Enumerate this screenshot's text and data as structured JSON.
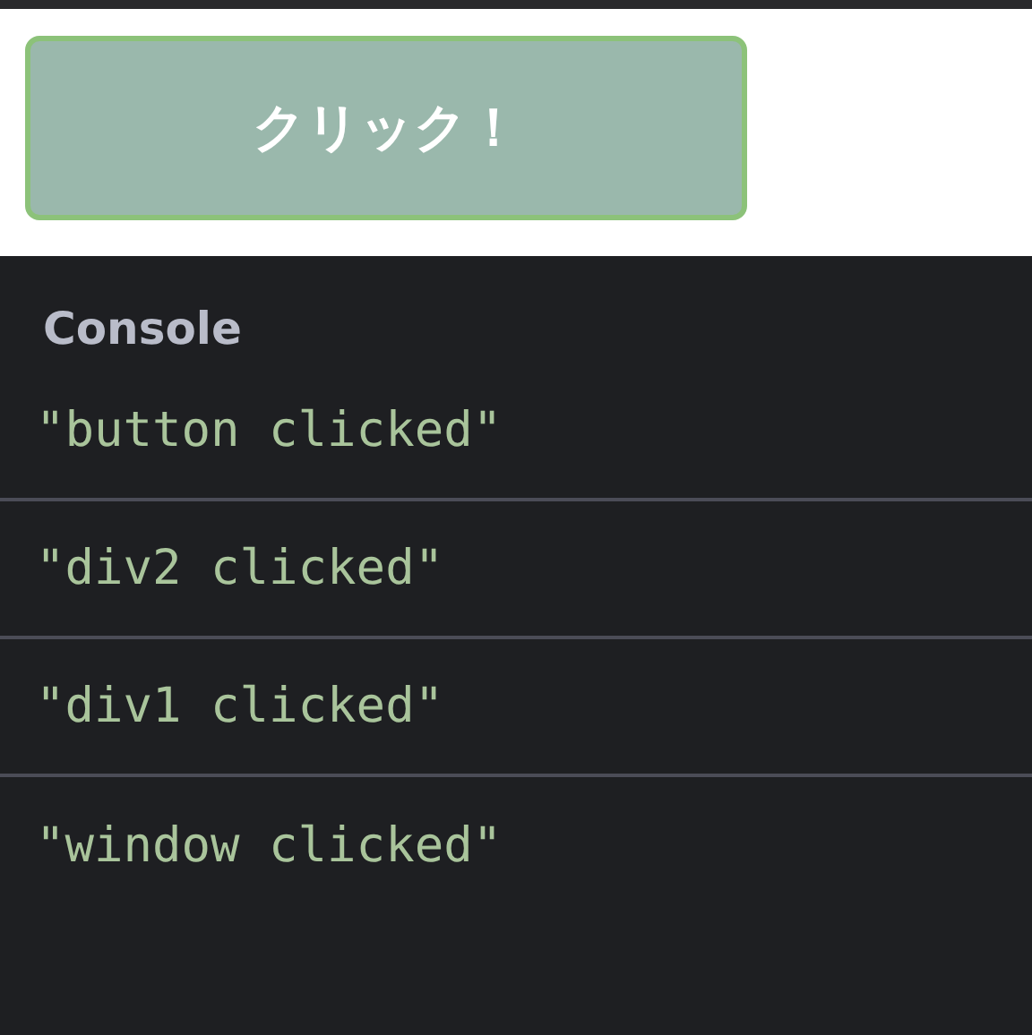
{
  "button": {
    "label": "クリック！"
  },
  "console": {
    "title": "Console",
    "logs": [
      {
        "text": "\"button clicked\""
      },
      {
        "text": "\"div2 clicked\""
      },
      {
        "text": "\"div1 clicked\""
      },
      {
        "text": "\"window clicked\""
      }
    ]
  }
}
